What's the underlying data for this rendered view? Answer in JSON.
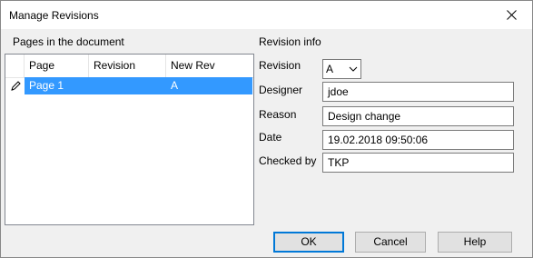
{
  "window": {
    "title": "Manage Revisions"
  },
  "left": {
    "section_label": "Pages in the document",
    "columns": [
      "Page",
      "Revision",
      "New Rev"
    ],
    "rows": [
      {
        "page": "Page 1",
        "revision": "",
        "new_rev": "A"
      }
    ]
  },
  "right": {
    "section_label": "Revision info",
    "revision_label": "Revision",
    "revision_value": "A",
    "designer_label": "Designer",
    "designer_value": "jdoe",
    "reason_label": "Reason",
    "reason_value": "Design change",
    "date_label": "Date",
    "date_value": "19.02.2018 09:50:06",
    "checked_label": "Checked by",
    "checked_value": "TKP"
  },
  "buttons": {
    "ok": "OK",
    "cancel": "Cancel",
    "help": "Help"
  },
  "colors": {
    "selection": "#3399ff",
    "default_button_border": "#0078d7"
  },
  "icons": {
    "row_header": "pencil-icon",
    "close": "close-icon",
    "dropdown": "chevron-down-icon"
  }
}
